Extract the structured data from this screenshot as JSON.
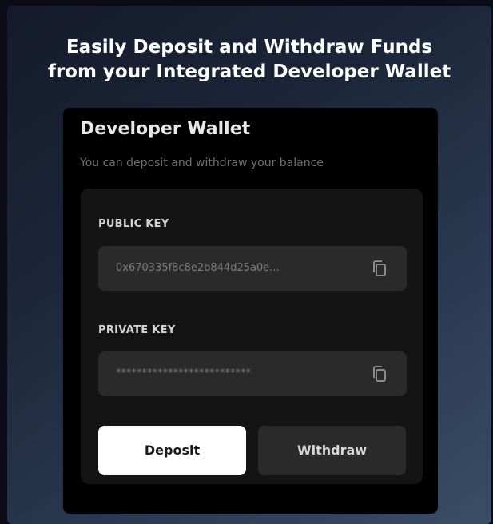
{
  "headline": "Easily Deposit and Withdraw Funds\nfrom your Integrated  Developer Wallet",
  "wallet": {
    "title": "Developer Wallet",
    "subtitle": "You can deposit and withdraw your balance",
    "public_key": {
      "label": "PUBLIC KEY",
      "value": "0x670335f8c8e2b844d25a0e...",
      "copy_icon": "copy-icon"
    },
    "private_key": {
      "label": "PRIVATE KEY",
      "value": "**************************",
      "copy_icon": "copy-icon"
    },
    "deposit_label": "Deposit",
    "withdraw_label": "Withdraw"
  },
  "colors": {
    "card_background": "#000000",
    "field_background": "#2a2a2a",
    "primary_button": "#ffffff",
    "secondary_button": "#2b2b2b"
  }
}
